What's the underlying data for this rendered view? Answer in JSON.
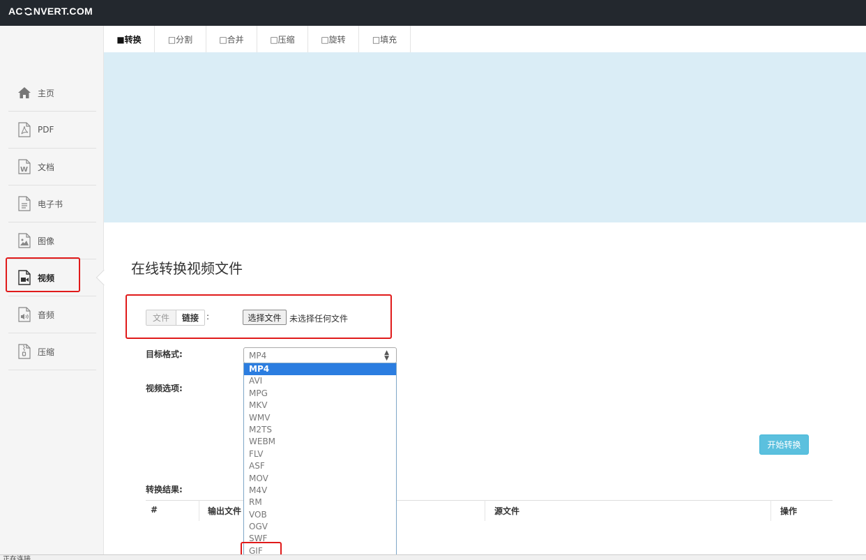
{
  "header": {
    "logo_prefix": "AC",
    "logo_suffix": "NVERT.COM"
  },
  "sidebar": {
    "items": [
      {
        "label": "主页",
        "icon": "home-icon"
      },
      {
        "label": "PDF",
        "icon": "pdf-file-icon"
      },
      {
        "label": "文档",
        "icon": "word-file-icon"
      },
      {
        "label": "电子书",
        "icon": "ebook-file-icon"
      },
      {
        "label": "图像",
        "icon": "image-file-icon"
      },
      {
        "label": "视频",
        "icon": "video-file-icon",
        "active": true
      },
      {
        "label": "音频",
        "icon": "audio-file-icon"
      },
      {
        "label": "压缩",
        "icon": "archive-file-icon"
      }
    ]
  },
  "tabs": [
    {
      "label": "■转换",
      "active": true
    },
    {
      "label": "□分割"
    },
    {
      "label": "□合并"
    },
    {
      "label": "□压缩"
    },
    {
      "label": "□旋转"
    },
    {
      "label": "□填充"
    }
  ],
  "main": {
    "title": "在线转换视频文件",
    "source": {
      "file_tab": "文件",
      "link_tab": "链接",
      "colon": ":",
      "choose_button": "选择文件",
      "no_file": "未选择任何文件"
    },
    "format": {
      "label": "目标格式:",
      "selected": "MP4",
      "options": [
        "MP4",
        "AVI",
        "MPG",
        "MKV",
        "WMV",
        "M2TS",
        "WEBM",
        "FLV",
        "ASF",
        "MOV",
        "M4V",
        "RM",
        "VOB",
        "OGV",
        "SWF",
        "GIF"
      ]
    },
    "video_options_label": "视频选项:",
    "start_button": "开始转换",
    "results": {
      "label": "转换结果:",
      "columns": [
        "#",
        "输出文件",
        "源文件",
        "操作"
      ]
    }
  },
  "statusbar": {
    "text": "正在连接..."
  },
  "colors": {
    "topbar": "#23282e",
    "banner": "#daedf6",
    "highlight": "#e01a1a",
    "selected_option": "#2b7de0",
    "start_button": "#5bc0de"
  }
}
